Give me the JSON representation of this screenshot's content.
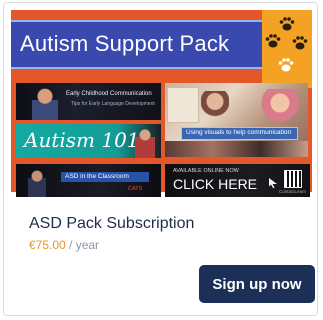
{
  "banner": {
    "title": "Autism Support Pack"
  },
  "thumbnails": {
    "early_childhood": {
      "line1": "Early Childhood Communication",
      "line2": "Tips for Early Language Development"
    },
    "using_visuals": {
      "caption": "Using visuals to help communication"
    },
    "autism_101": {
      "title": "Autism 101"
    },
    "asd_classroom": {
      "caption": "ASD in the Classroom",
      "logo": "CATS"
    },
    "click_here": {
      "line1": "AVAILABLE ONLINE NOW",
      "line2": "CLICK HERE",
      "brand": "ContactLearn"
    }
  },
  "product": {
    "title": "ASD Pack Subscription",
    "price": "€75.00",
    "period": " / year"
  },
  "actions": {
    "signup_label": "Sign up now"
  },
  "colors": {
    "banner_orange": "#e4572a",
    "title_bar_blue": "#3a49ae",
    "paw_panel": "#f4a223",
    "price_orange": "#e8942f",
    "button_navy": "#1c2f57"
  }
}
